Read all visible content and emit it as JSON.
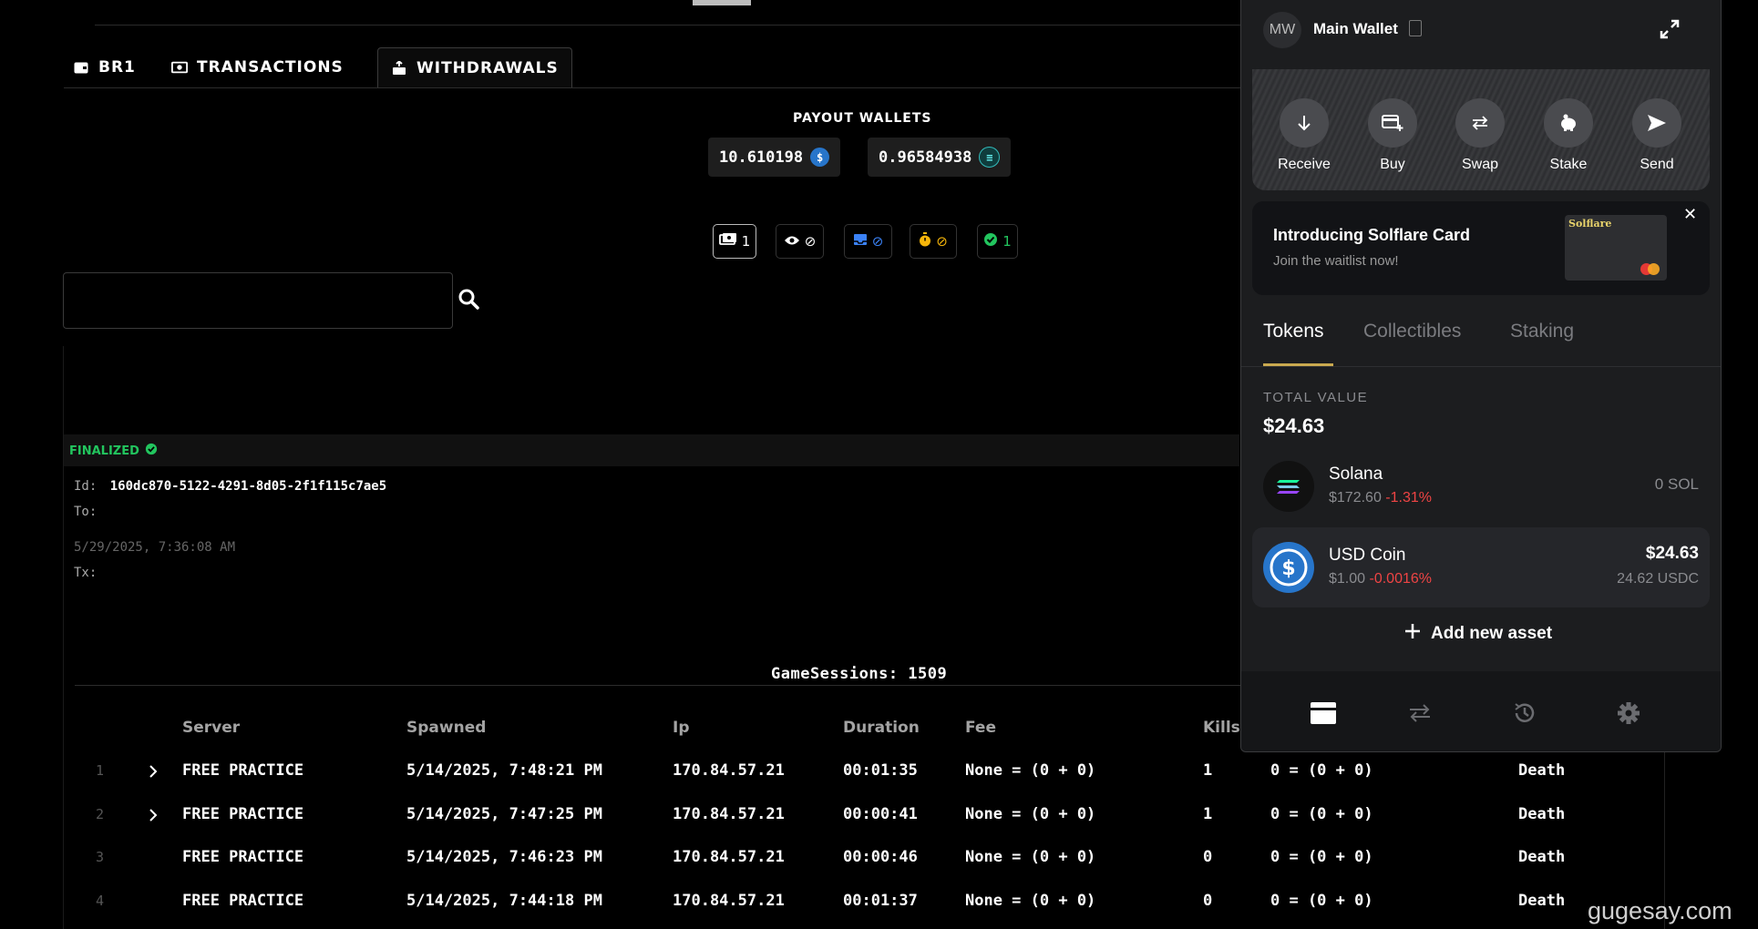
{
  "tabs": [
    {
      "label": "BR1",
      "icon": "wallet-icon"
    },
    {
      "label": "TRANSACTIONS",
      "icon": "money-icon"
    },
    {
      "label": "WITHDRAWALS",
      "icon": "withdraw-icon",
      "active": true
    }
  ],
  "payout": {
    "title": "PAYOUT WALLETS",
    "wallets": [
      {
        "amount": "10.610198",
        "coin": "usdc-icon",
        "color": "#2775ca"
      },
      {
        "amount": "0.96584938",
        "coin": "sol-icon",
        "color": "#1e7a7a"
      }
    ]
  },
  "filters": [
    {
      "icon": "cash-icon",
      "count": "1",
      "color": "#ffffff"
    },
    {
      "icon": "eye-icon",
      "count": "⊘",
      "color": "#ffffff"
    },
    {
      "icon": "inbox-icon",
      "count": "⊘",
      "color": "#3b82f6"
    },
    {
      "icon": "stopwatch-icon",
      "count": "⊘",
      "color": "#f5b50a"
    },
    {
      "icon": "check-circle-icon",
      "count": "1",
      "color": "#22c55e"
    }
  ],
  "search": {
    "placeholder": ""
  },
  "withdrawal": {
    "status": "FINALIZED",
    "id_label": "Id:",
    "id": "160dc870-5122-4291-8d05-2f1f115c7ae5",
    "to_label": "To:",
    "date": "5/29/2025, 7:36:08 AM",
    "tx_label": "Tx:"
  },
  "sessions": {
    "title": "GameSessions: 1509",
    "columns": [
      "Server",
      "Spawned",
      "Ip",
      "Duration",
      "Fee",
      "Kills"
    ],
    "rows": [
      {
        "index": "1",
        "server": "FREE PRACTICE",
        "spawned": "5/14/2025, 7:48:21 PM",
        "ip": "170.84.57.21",
        "duration": "00:01:35",
        "fee": "None = (0 + 0)",
        "kills": "1",
        "reward": "0 = (0 + 0)",
        "end": "Death",
        "expandable": true
      },
      {
        "index": "2",
        "server": "FREE PRACTICE",
        "spawned": "5/14/2025, 7:47:25 PM",
        "ip": "170.84.57.21",
        "duration": "00:00:41",
        "fee": "None = (0 + 0)",
        "kills": "1",
        "reward": "0 = (0 + 0)",
        "end": "Death",
        "expandable": true
      },
      {
        "index": "3",
        "server": "FREE PRACTICE",
        "spawned": "5/14/2025, 7:46:23 PM",
        "ip": "170.84.57.21",
        "duration": "00:00:46",
        "fee": "None = (0 + 0)",
        "kills": "0",
        "reward": "0 = (0 + 0)",
        "end": "Death",
        "expandable": false
      },
      {
        "index": "4",
        "server": "FREE PRACTICE",
        "spawned": "5/14/2025, 7:44:18 PM",
        "ip": "170.84.57.21",
        "duration": "00:01:37",
        "fee": "None = (0 + 0)",
        "kills": "0",
        "reward": "0 = (0 + 0)",
        "end": "Death",
        "expandable": false
      }
    ]
  },
  "wallet": {
    "avatar": "MW",
    "name": "Main Wallet",
    "actions": [
      "Receive",
      "Buy",
      "Swap",
      "Stake",
      "Send"
    ],
    "promo": {
      "title": "Introducing Solflare Card",
      "subtitle": "Join the waitlist now!",
      "card_brand": "Solflare"
    },
    "tabs": [
      "Tokens",
      "Collectibles",
      "Staking"
    ],
    "total_label": "TOTAL VALUE",
    "total_value": "$24.63",
    "assets": [
      {
        "name": "Solana",
        "price": "$172.60",
        "change": "-1.31%",
        "balance": "0 SOL"
      },
      {
        "name": "USD Coin",
        "price": "$1.00",
        "change": "-0.0016%",
        "usd": "$24.63",
        "amount": "24.62 USDC"
      }
    ],
    "add_asset": "Add new asset",
    "accent": "#c9a94f"
  },
  "watermark": "gugesay.com"
}
